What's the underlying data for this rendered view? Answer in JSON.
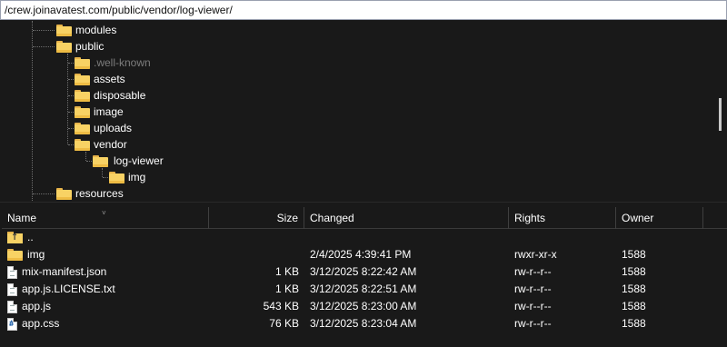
{
  "path_bar": {
    "value": "/crew.joinavatest.com/public/vendor/log-viewer/"
  },
  "tree": {
    "nodes": [
      {
        "label": "modules",
        "dim": false
      },
      {
        "label": "public",
        "dim": false
      },
      {
        "label": ".well-known",
        "dim": true
      },
      {
        "label": "assets",
        "dim": false
      },
      {
        "label": "disposable",
        "dim": false
      },
      {
        "label": "image",
        "dim": false
      },
      {
        "label": "uploads",
        "dim": false
      },
      {
        "label": "vendor",
        "dim": false
      },
      {
        "label": "log-viewer",
        "dim": false
      },
      {
        "label": "img",
        "dim": false
      },
      {
        "label": "resources",
        "dim": false
      }
    ]
  },
  "list": {
    "columns": {
      "name": "Name",
      "size": "Size",
      "changed": "Changed",
      "rights": "Rights",
      "owner": "Owner"
    },
    "rows": [
      {
        "name": "..",
        "icon": "parent-folder-icon",
        "size": "",
        "changed": "",
        "rights": "",
        "owner": ""
      },
      {
        "name": "img",
        "icon": "folder-icon",
        "size": "",
        "changed": "2/4/2025 4:39:41 PM",
        "rights": "rwxr-xr-x",
        "owner": "1588"
      },
      {
        "name": "mix-manifest.json",
        "icon": "json-file-icon",
        "size": "1 KB",
        "changed": "3/12/2025 8:22:42 AM",
        "rights": "rw-r--r--",
        "owner": "1588"
      },
      {
        "name": "app.js.LICENSE.txt",
        "icon": "text-file-icon",
        "size": "1 KB",
        "changed": "3/12/2025 8:22:51 AM",
        "rights": "rw-r--r--",
        "owner": "1588"
      },
      {
        "name": "app.js",
        "icon": "js-file-icon",
        "size": "543 KB",
        "changed": "3/12/2025 8:23:00 AM",
        "rights": "rw-r--r--",
        "owner": "1588"
      },
      {
        "name": "app.css",
        "icon": "css-file-icon",
        "size": "76 KB",
        "changed": "3/12/2025 8:23:04 AM",
        "rights": "rw-r--r--",
        "owner": "1588"
      }
    ]
  },
  "colors": {
    "background": "#191919",
    "folder": "#f8d264",
    "path_selection": "#cce3f7"
  }
}
